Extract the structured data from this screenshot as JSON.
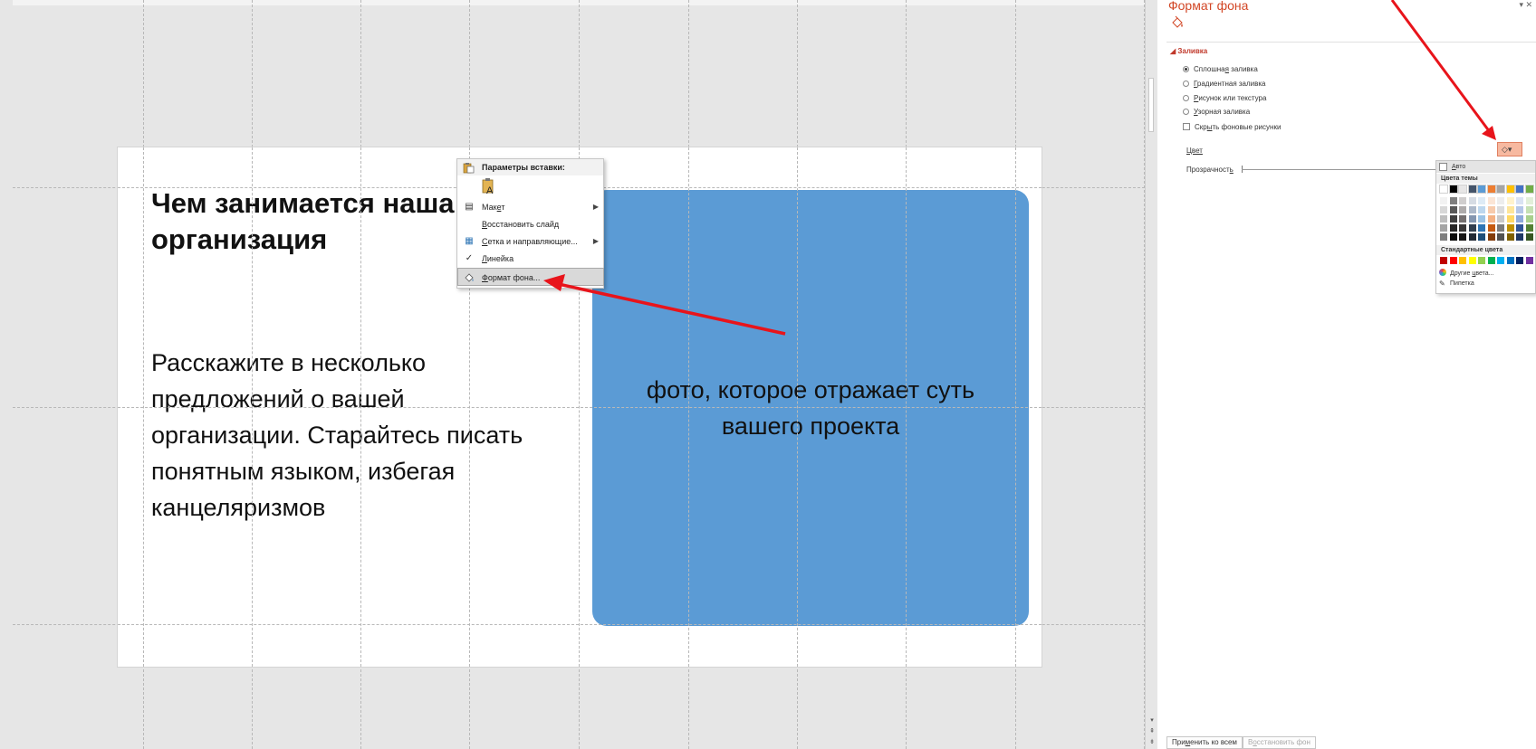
{
  "slide": {
    "title": "Чем занимается наша организация",
    "body": "Расскажите в несколько предложений о вашей организации. Старайтесь писать понятным языком, избегая канцеляризмов",
    "photo_placeholder": "фото, которое отражает суть вашего проекта"
  },
  "context_menu": {
    "header": "Параметры вставки:",
    "items": [
      {
        "pre": "Мак",
        "u": "е",
        "post": "т"
      },
      {
        "pre": "",
        "u": "В",
        "post": "осстановить слайд"
      },
      {
        "pre": "",
        "u": "С",
        "post": "етка и направляющие..."
      },
      {
        "pre": "",
        "u": "Л",
        "post": "инейка"
      },
      {
        "pre": "",
        "u": "Ф",
        "post": "ормат фона..."
      }
    ]
  },
  "format_pane": {
    "title": "Формат фона",
    "controls": "▾ ✕",
    "section_fill": "Заливка",
    "fill_options": [
      {
        "pre": "Сплошна",
        "u": "я",
        "post": " заливка",
        "selected": true
      },
      {
        "pre": "",
        "u": "Г",
        "post": "радиентная заливка",
        "selected": false
      },
      {
        "pre": "",
        "u": "Р",
        "post": "исунок или текстура",
        "selected": false
      },
      {
        "pre": "",
        "u": "У",
        "post": "зорная заливка",
        "selected": false
      }
    ],
    "hide_bg_pre": "Скр",
    "hide_bg_u": "ы",
    "hide_bg_post": "ть фоновые рисунки",
    "color_label": "Цвет",
    "transparency_pre": "Прозрачност",
    "transparency_u": "ь",
    "apply_all_pre": "При",
    "apply_all_u": "м",
    "apply_all_post": "енить ко всем",
    "reset_pre": "В",
    "reset_u": "о",
    "reset_post": "сстановить фон"
  },
  "color_dropdown": {
    "auto_pre": "",
    "auto_u": "А",
    "auto_post": "вто",
    "theme_colors_label": "Цвета темы",
    "standard_colors_label": "Стандартные цвета",
    "more_colors_pre": "Другие ",
    "more_colors_u": "ц",
    "more_colors_post": "вета...",
    "eyedropper": "Пипетка",
    "theme_top": [
      "#ffffff",
      "#000000",
      "#e7e6e6",
      "#44546a",
      "#5b9bd5",
      "#ed7d31",
      "#a5a5a5",
      "#ffc000",
      "#4472c4",
      "#70ad47"
    ],
    "theme_shades": [
      [
        "#f2f2f2",
        "#7f7f7f",
        "#d0cece",
        "#d6dce4",
        "#deebf6",
        "#fbe5d5",
        "#ededed",
        "#fff2cc",
        "#dae3f3",
        "#e2efd9"
      ],
      [
        "#d8d8d8",
        "#595959",
        "#aeabab",
        "#adb9ca",
        "#bdd7ee",
        "#f7cbac",
        "#dbdbdb",
        "#fee599",
        "#b4c6e7",
        "#c5e0b3"
      ],
      [
        "#bfbfbf",
        "#3f3f3f",
        "#757070",
        "#8496b0",
        "#9cc3e5",
        "#f4b183",
        "#c9c9c9",
        "#ffd965",
        "#8eaadb",
        "#a8d08d"
      ],
      [
        "#a5a5a5",
        "#262626",
        "#3a3838",
        "#323f4f",
        "#2e75b5",
        "#c55a11",
        "#7b7b7b",
        "#bf9000",
        "#2f5496",
        "#538135"
      ],
      [
        "#7f7f7f",
        "#0c0c0c",
        "#171616",
        "#222a35",
        "#1e4e79",
        "#833c0b",
        "#525252",
        "#7f6000",
        "#1f3864",
        "#375623"
      ]
    ],
    "standard": [
      "#c00000",
      "#ff0000",
      "#ffc000",
      "#ffff00",
      "#92d050",
      "#00b050",
      "#00b0f0",
      "#0070c0",
      "#002060",
      "#7030a0"
    ]
  },
  "annotation_color": "#e8141b"
}
